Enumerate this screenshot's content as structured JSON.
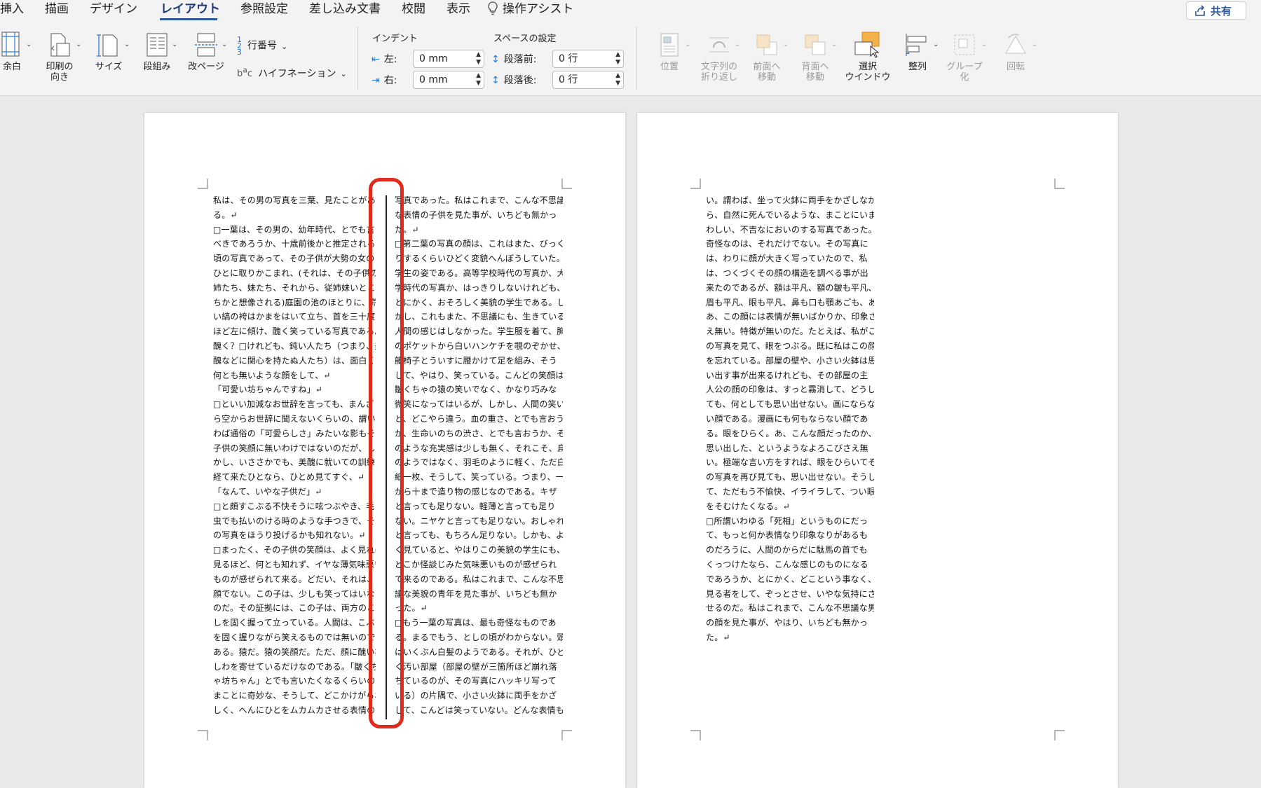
{
  "tabs": [
    {
      "label": "挿入",
      "active": false
    },
    {
      "label": "描画",
      "active": false
    },
    {
      "label": "デザイン",
      "active": false
    },
    {
      "label": "レイアウト",
      "active": true
    },
    {
      "label": "参照設定",
      "active": false
    },
    {
      "label": "差し込み文書",
      "active": false
    },
    {
      "label": "校閲",
      "active": false
    },
    {
      "label": "表示",
      "active": false
    }
  ],
  "assist": {
    "label": "操作アシスト"
  },
  "share": {
    "label": "共有"
  },
  "ribbon": {
    "margins": "余白",
    "orientation": "印刷の\n向き",
    "size": "サイズ",
    "columns": "段組み",
    "breaks": "改ページ",
    "line_numbers": "行番号",
    "hyphenation": "ハイフネーション",
    "indent_header": "インデント",
    "spacing_header": "スペースの設定",
    "left_label": "左:",
    "right_label": "右:",
    "left_value": "0 mm",
    "right_value": "0 mm",
    "before_label": "段落前:",
    "after_label": "段落後:",
    "before_value": "0 行",
    "after_value": "0 行",
    "position": "位置",
    "wrap": "文字列の\n折り返し",
    "bring_forward": "前面へ\n移動",
    "send_backward": "背面へ\n移動",
    "selection_pane": "選択\nウインドウ",
    "align": "整列",
    "group": "グループ\n化",
    "rotate": "回転"
  },
  "page1": {
    "left_col": [
      "私は、その男の写真を三葉、見たことがあ",
      "る。↵",
      "□一葉は、その男の、幼年時代、とでも言う",
      "べきであろうか、十歳前後かと推定される",
      "頃の写真であって、その子供が大勢の女の",
      "ひとに取りかこまれ、(それは、その子供の",
      "姉たち、妹たち、それから、従姉妹いとこた",
      "ちかと想像される)庭園の池のほとりに、荒",
      "い縞の袴はかまをはいて立ち、首を三十度",
      "ほど左に傾け、醜く笑っている写真である。",
      "醜く？□けれども、鈍い人たち（つまり、美",
      "醜などに関心を持たぬ人たち）は、面白くも",
      "何とも無いような顔をして、↵",
      "「可愛い坊ちゃんですね」↵",
      "□といい加減なお世辞を言っても、まんざ",
      "ら空からお世辞に聞えないくらいの、謂い",
      "わば通俗の「可愛らしさ」みたいな影もその",
      "子供の笑顔に無いわけではないのだが、し",
      "かし、いささかでも、美醜に就いての訓練を",
      "経て来たひとなら、ひとめ見てすぐ、↵",
      "「なんて、いやな子供だ」↵",
      "□と頗すこぶる不快そうに呟つぶやき、毛",
      "虫でも払いのける時のような手つきで、そ",
      "の写真をほうり投げるかも知れない。↵",
      "□まったく、その子供の笑顔は、よく見れば",
      "見るほど、何とも知れず、イヤな薄気味悪い",
      "ものが感ぜられて来る。どだい、それは、笑",
      "顔でない。この子は、少しも笑ってはいない",
      "のだ。その証拠には、この子は、両方のこぶ",
      "しを固く握って立っている。人間は、こぶし",
      "を固く握りながら笑えるものでは無いので",
      "ある。猿だ。猿の笑顔だ。ただ、顔に醜い皺",
      "しわを寄せているだけなのである。「皺くち",
      "ゃ坊ちゃん」とでも言いたくなるくらいの、",
      "まことに奇妙な、そうして、どこかけがらわ",
      "しく、へんにひとをムカムカさせる表情の"
    ],
    "right_col": [
      "写真であった。私はこれまで、こんな不思議",
      "な表情の子供を見た事が、いちども無かっ",
      "た。↵",
      "□第二葉の写真の顔は、これはまた、びっく",
      "りするくらいひどく変貌へんぼうしていた。",
      "学生の姿である。高等学校時代の写真か、大",
      "学時代の写真か、はっきりしないけれども、",
      "とにかく、おそろしく美貌の学生である。し",
      "かし、これもまた、不思議にも、生きている",
      "人間の感じはしなかった。学生服を着て、胸",
      "のポケットから白いハンケチを覗のぞかせ、",
      "籐椅子とういすに腰かけて足を組み、そう",
      "して、やはり、笑っている。こんどの笑顔は、",
      "皺くちゃの猿の笑いでなく、かなり巧みな",
      "微笑になってはいるが、しかし、人間の笑い",
      "と、どこやら違う。血の重さ、とでも言おう",
      "か、生命いのちの渋さ、とでも言おうか、そ",
      "のような充実感は少しも無く、それこそ、鳥",
      "のようではなく、羽毛のように軽く、ただ白",
      "紙一枚、そうして、笑っている。つまり、一",
      "から十まで造り物の感じなのである。キザ",
      "と言っても足りない。軽薄と言っても足り",
      "ない。ニヤケと言っても足りない。おしゃれ",
      "と言っても、もちろん足りない。しかも、よ",
      "く見ていると、やはりこの美貌の学生にも、",
      "どこか怪談じみた気味悪いものが感ぜられ",
      "て来るのである。私はこれまで、こんな不思",
      "議な美貌の青年を見た事が、いちども無か",
      "った。↵",
      "□もう一葉の写真は、最も奇怪なものであ",
      "る。まるでもう、としの頃がわからない。頭",
      "はいくぶん白髪のようである。それが、ひど",
      "く汚い部屋（部屋の壁が三箇所ほど崩れ落",
      "ちているのが、その写真にハッキリ写って",
      "いる）の片隅で、小さい火鉢に両手をかざ",
      "して、こんどは笑っていない。どんな表情も無"
    ]
  },
  "page2": {
    "col": [
      "い。謂わば、坐って火鉢に両手をかざしなが",
      "ら、自然に死んでいるような、まことにいま",
      "わしい、不吉なにおいのする写真であった。",
      "奇怪なのは、それだけでない。その写真に",
      "は、わりに顔が大きく写っていたので、私",
      "は、つくづくその顔の構造を調べる事が出",
      "来たのであるが、額は平凡、額の皺も平凡、",
      "眉も平凡、眼も平凡、鼻も口も顎あごも、あ",
      "あ、この顔には表情が無いばかりか、印象さ",
      "え無い。特徴が無いのだ。たとえば、私がこ",
      "の写真を見て、眼をつぶる。既に私はこの顔",
      "を忘れている。部屋の壁や、小さい火鉢は思",
      "い出す事が出来るけれども、その部屋の主",
      "人公の顔の印象は、すっと霧消して、どうし",
      "ても、何としても思い出せない。画にならな",
      "い顔である。漫画にも何もならない顔であ",
      "る。眼をひらく。あ、こんな顔だったのか、",
      "思い出した、というようなよろこびさえ無",
      "い。極端な言い方をすれば、眼をひらいてそ",
      "の写真を再び見ても、思い出せない。そうし",
      "て、ただもう不愉快、イライラして、つい眼",
      "をそむけたくなる。↵",
      "□所謂いわゆる「死相」というものにだっ",
      "て、もっと何か表情なり印象なりがあるも",
      "のだろうに、人間のからだに駄馬の首でも",
      "くっつけたなら、こんな感じのものになる",
      "であろうか、とにかく、どこという事なく、",
      "見る者をして、ぞっとさせ、いやな気持にさ",
      "せるのだ。私はこれまで、こんな不思議な男",
      "の顔を見た事が、やはり、いちども無かっ",
      "た。↵"
    ]
  },
  "colors": {
    "highlight": "#e02a1c",
    "accent": "#2b579a"
  }
}
